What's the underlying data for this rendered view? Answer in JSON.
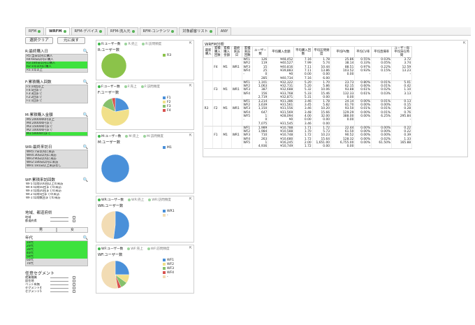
{
  "tabs": [
    {
      "label": "RFM",
      "dot": true,
      "active": false
    },
    {
      "label": "WRFM",
      "dot": true,
      "active": true
    },
    {
      "label": "RFM-デバイス",
      "dot": true,
      "active": false
    },
    {
      "label": "RFM-流入元",
      "dot": true,
      "active": false
    },
    {
      "label": "RFM-コンテンツ",
      "dot": true,
      "active": false
    },
    {
      "label": "対象顧客リスト",
      "dot": true,
      "active": false
    },
    {
      "label": "ANY",
      "dot": false,
      "active": false
    }
  ],
  "left": {
    "select_btn": "選択クリア",
    "back_btn": "元に戻す",
    "r_box": {
      "title": "R:最終購入日",
      "items": [
        {
          "text": "R5:当日以内に購入",
          "sel": false
        },
        {
          "text": "R4:60日以内に購入",
          "sel": false
        },
        {
          "text": "R3:180日以内に購入",
          "sel": true
        },
        {
          "text": "R2:1年以内に購入",
          "sel": true
        },
        {
          "text": "R1:1年以上",
          "sel": false
        }
      ]
    },
    "f_box": {
      "title": "F:累積購入回数",
      "items": [
        {
          "text": "F5:10回以上",
          "sel": false
        },
        {
          "text": "F4:5回まで",
          "sel": false
        },
        {
          "text": "F3:3回まで",
          "sel": false
        },
        {
          "text": "F2:2回まで",
          "sel": false
        },
        {
          "text": "F1:1回まで",
          "sel": false
        }
      ]
    },
    "m_box": {
      "title": "M:累積購入金額",
      "items": [
        {
          "text": "M5:2000000円以上",
          "sel": false
        },
        {
          "text": "M4:200000円まで",
          "sel": false
        },
        {
          "text": "M3:150000円まで",
          "sel": false
        },
        {
          "text": "M2:100000円まで",
          "sel": false
        },
        {
          "text": "M1:50000円まで",
          "sel": true
        }
      ]
    },
    "wr_box": {
      "title": "WR:最終来訪日",
      "items": [
        {
          "text": "WR5:7日以内に来訪",
          "sel": false
        },
        {
          "text": "WR4:30日以内に来訪",
          "sel": false
        },
        {
          "text": "WR3:90日以内に来訪",
          "sel": false
        },
        {
          "text": "WR2:180日以内に来訪",
          "sel": false
        },
        {
          "text": "WR1:181日以上来訪なし",
          "sel": false
        }
      ]
    },
    "wf_box": {
      "title": "WF:累積来訪回数",
      "items": [
        {
          "text": "WF5:年間100回以上の来訪",
          "sel": false
        },
        {
          "text": "WF4:年間50回までの来訪",
          "sel": false
        },
        {
          "text": "WF3:年間20回までの来訪",
          "sel": false
        },
        {
          "text": "WF2:年間5回までの来訪",
          "sel": false
        },
        {
          "text": "WF1:年間数回までの来訪",
          "sel": false
        }
      ]
    },
    "region": {
      "title": "地域、都道府県",
      "rows": [
        "地域",
        "都道府県"
      ]
    },
    "gender": [
      "男",
      "女"
    ],
    "age": {
      "title": "年代",
      "items": [
        {
          "text": "10代",
          "sel": true
        },
        {
          "text": "20代",
          "sel": true
        },
        {
          "text": "30代",
          "sel": true
        },
        {
          "text": "40代",
          "sel": true
        },
        {
          "text": "50代",
          "sel": true
        },
        {
          "text": "60代",
          "sel": false
        },
        {
          "text": "70代",
          "sel": false
        }
      ]
    },
    "segment": {
      "title": "任意セグメント",
      "rows": [
        "就業種属",
        "居住地",
        "ペット有無",
        "セグメント4",
        "セグメント5"
      ]
    }
  },
  "panels": [
    {
      "tabs": [
        "R:ユーザー数",
        "R:売上",
        "R:訪問頻度"
      ],
      "title": "R:ユーザー数",
      "legend": [
        {
          "label": "R3",
          "color": "#8bc34a"
        }
      ],
      "pie": [
        {
          "value": 1,
          "color": "#8bc34a"
        }
      ]
    },
    {
      "tabs": [
        "F:ユーザー数",
        "F:売上",
        "F:訪問頻度"
      ],
      "title": "F:ユーザー数",
      "legend": [
        {
          "label": "F1",
          "color": "#4a90d9"
        },
        {
          "label": "F2",
          "color": "#f1e08a"
        },
        {
          "label": "F3",
          "color": "#86c06c"
        },
        {
          "label": "F4",
          "color": "#d9534f"
        }
      ],
      "pie": [
        {
          "value": 22,
          "color": "#4a90d9"
        },
        {
          "value": 60,
          "color": "#f1e08a"
        },
        {
          "value": 14,
          "color": "#86c06c"
        },
        {
          "value": 4,
          "color": "#d9534f"
        }
      ]
    },
    {
      "tabs": [
        "M:ユーザー数",
        "M:売上",
        "M:訪問頻度"
      ],
      "title": "M:ユーザー数",
      "legend": [
        {
          "label": "M1",
          "color": "#4a90d9"
        }
      ],
      "pie": [
        {
          "value": 1,
          "color": "#4a90d9"
        }
      ]
    },
    {
      "tabs": [
        "WR:ユーザー数",
        "WR:売上",
        "WR:訪問頻度"
      ],
      "title": "WR:ユーザー数",
      "legend": [
        {
          "label": "WR1",
          "color": "#4a90d9"
        },
        {
          "label": "-",
          "color": "#f2dcb4"
        }
      ],
      "pie": [
        {
          "value": 52,
          "color": "#4a90d9"
        },
        {
          "value": 48,
          "color": "#f2dcb4"
        }
      ]
    },
    {
      "tabs": [
        "WF:ユーザー数",
        "WF:売上",
        "WF:訪問頻度"
      ],
      "title": "WF:ユーザー数",
      "legend": [
        {
          "label": "WF1",
          "color": "#4a90d9"
        },
        {
          "label": "WF2",
          "color": "#f1e08a"
        },
        {
          "label": "WF3",
          "color": "#86c06c"
        },
        {
          "label": "WF4",
          "color": "#d9534f"
        },
        {
          "label": "-",
          "color": "#f2dcb4"
        }
      ],
      "pie": [
        {
          "value": 25,
          "color": "#4a90d9"
        },
        {
          "value": 10,
          "color": "#f1e08a"
        },
        {
          "value": 8,
          "color": "#86c06c"
        },
        {
          "value": 4,
          "color": "#d9534f"
        },
        {
          "value": 53,
          "color": "#f2dcb4"
        }
      ]
    }
  ],
  "table": {
    "title": "WRFM分析",
    "headers": [
      "最新購入",
      "累積購入回数",
      "累積購入金額",
      "最終来訪日",
      "累積来訪回数",
      "ユーザー数",
      "平均購入金額",
      "平均購入回数",
      "平均訪問頻度",
      "平均PV数",
      "平均CV率",
      "平均直帰率",
      "ユーザー毎平均滞在時間"
    ],
    "rows": [
      [
        "",
        "",
        "",
        "",
        "WF1",
        "126",
        "¥48,452",
        "7.16",
        "1.78",
        "25.86",
        "0.55%",
        "0.03%",
        "3.72"
      ],
      [
        "",
        "",
        "",
        "",
        "WF2",
        "119",
        "¥40,527",
        "7.99",
        "5.74",
        "38.14",
        "0.33%",
        "0.05%",
        "3.74"
      ],
      [
        "",
        "F4",
        "M1",
        "WR1",
        "WF3",
        "15",
        "¥40,816",
        "7.11",
        "10.44",
        "88.51",
        "0.97%",
        "0.22%",
        "12.59"
      ],
      [
        "",
        "",
        "",
        "",
        "WF4",
        "25",
        "¥39,883",
        "7.11",
        "13.86",
        "103.52",
        "0.93%",
        "0.15%",
        "13.23"
      ],
      [
        "",
        "",
        "",
        "",
        "-",
        "0",
        "¥0",
        "0.00",
        "0.00",
        "0.00",
        "-",
        "-",
        "-"
      ],
      [
        "",
        "",
        "",
        "",
        "",
        "285",
        "¥40,734",
        "7.16",
        "6.00",
        "",
        "",
        "",
        ""
      ],
      [
        "",
        "",
        "",
        "",
        "WF1",
        "1,101",
        "¥32,322",
        "5.20",
        "1.70",
        "23.73",
        "0.80%",
        "0.01%",
        "5.01"
      ],
      [
        "",
        "",
        "",
        "",
        "WF2",
        "1,063",
        "¥32,731",
        "5.20",
        "5.86",
        "62.15",
        "0.60%",
        "0.01%",
        "0.42"
      ],
      [
        "",
        "F3",
        "M1",
        "WR1",
        "WF3",
        "387",
        "¥32,688",
        "5.32",
        "10.06",
        "93.88",
        "0.61%",
        "0.02%",
        "1.10"
      ],
      [
        "",
        "",
        "",
        "",
        "WF4",
        "156",
        "¥33,768",
        "5.33",
        "15.46",
        "132.33",
        "0.61%",
        "0.03%",
        "3.13"
      ],
      [
        "",
        "",
        "",
        "",
        "",
        "2,719",
        "¥32,871",
        "5.31",
        "0.00",
        "0.00",
        "",
        "",
        ""
      ],
      [
        "",
        "",
        "",
        "",
        "WF1",
        "3,214",
        "¥31,386",
        "3.46",
        "1.78",
        "24.14",
        "0.00%",
        "0.01%",
        "0.13"
      ],
      [
        "",
        "",
        "",
        "",
        "WF2",
        "3,639",
        "¥31,561",
        "3.45",
        "5.82",
        "61.70",
        "0.00%",
        "0.00%",
        "0.15"
      ],
      [
        "R3",
        "F2",
        "M1",
        "WR1",
        "WF3",
        "1,150",
        "¥31,556",
        "3.46",
        "10.20",
        "93.50",
        "0.01%",
        "0.01%",
        "0.28"
      ],
      [
        "",
        "",
        "",
        "",
        "WF4",
        "647",
        "¥31,569",
        "3.48",
        "15.66",
        "129.29",
        "0.00%",
        "0.01%",
        "0.76"
      ],
      [
        "",
        "",
        "",
        "",
        "WF5",
        "1",
        "¥28,094",
        "4.00",
        "32.00",
        "388.00",
        "0.00%",
        "6.25%",
        "295.84"
      ],
      [
        "",
        "",
        "",
        "",
        "-",
        "0",
        "¥0",
        "0.00",
        "0.00",
        "0.00",
        "-",
        "-",
        "-"
      ],
      [
        "",
        "",
        "",
        "",
        "",
        "7,075",
        "¥31,545",
        "3.46",
        "0.00",
        "",
        "",
        "",
        ""
      ],
      [
        "",
        "",
        "",
        "",
        "WF1",
        "1,989",
        "¥10,788",
        "1.71",
        "1.72",
        "22.44",
        "0.00%",
        "0.00%",
        "0.22"
      ],
      [
        "",
        "",
        "",
        "",
        "WF2",
        "1,984",
        "¥10,588",
        "1.70",
        "5.73",
        "61.50",
        "0.00%",
        "0.00%",
        "0.22"
      ],
      [
        "",
        "F1",
        "M1",
        "WR1",
        "WF3",
        "710",
        "¥10,748",
        "1.72",
        "10.23",
        "90.52",
        "0.00%",
        "0.00%",
        "0.39"
      ],
      [
        "",
        "",
        "",
        "",
        "WF4",
        "263",
        "¥10,680",
        "1.72",
        "15.64",
        "128.32",
        "0.00%",
        "0.02%",
        "1.33"
      ],
      [
        "",
        "",
        "",
        "",
        "WF5",
        "1",
        "¥16,245",
        "2.00",
        "1,651.00",
        "6,755.00",
        "0.00%",
        "61.50%",
        "165.88"
      ],
      [
        "",
        "",
        "",
        "",
        "",
        "4,936",
        "¥10,749",
        "1.72",
        "0.00",
        "0.00",
        "-",
        "",
        ""
      ]
    ]
  }
}
